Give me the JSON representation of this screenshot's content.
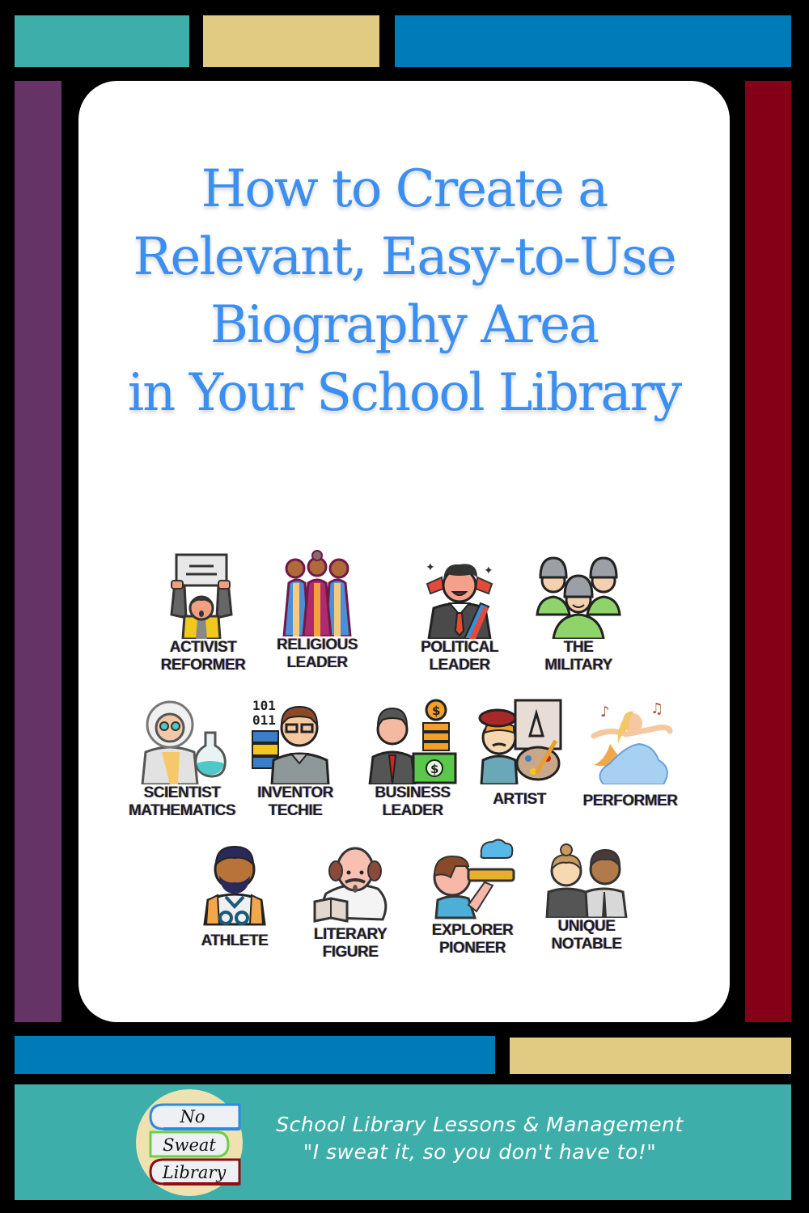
{
  "colors": {
    "teal": "#3eaeab",
    "tan": "#e1cb82",
    "blue": "#007bba",
    "purple": "#653366",
    "red": "#850017",
    "title_blue": "#3a8ff0"
  },
  "title": {
    "lines": [
      "How to Create a",
      "Relevant, Easy-to-Use",
      "Biography Area",
      "in Your School Library"
    ]
  },
  "categories": [
    {
      "icon": "activist-protester-icon",
      "lines": [
        "ACTIVIST",
        "REFORMER"
      ]
    },
    {
      "icon": "religious-leaders-icon",
      "lines": [
        "RELIGIOUS",
        "LEADER"
      ]
    },
    {
      "icon": "political-leader-icon",
      "lines": [
        "POLITICAL",
        "LEADER"
      ]
    },
    {
      "icon": "soldiers-icon",
      "lines": [
        "THE",
        "MILITARY"
      ]
    },
    {
      "icon": "scientist-flask-icon",
      "lines": [
        "SCIENTIST",
        "MATHEMATICS"
      ]
    },
    {
      "icon": "inventor-techie-icon",
      "lines": [
        "INVENTOR",
        "TECHIE"
      ]
    },
    {
      "icon": "businessman-money-icon",
      "lines": [
        "BUSINESS",
        "LEADER"
      ]
    },
    {
      "icon": "artist-palette-icon",
      "lines": [
        "ARTIST"
      ]
    },
    {
      "icon": "performer-singer-icon",
      "lines": [
        "PERFORMER"
      ]
    },
    {
      "icon": "athlete-icon",
      "lines": [
        "ATHLETE"
      ]
    },
    {
      "icon": "literary-figure-icon",
      "lines": [
        "LITERARY",
        "FIGURE"
      ]
    },
    {
      "icon": "explorer-spyglass-icon",
      "lines": [
        "EXPLORER",
        "PIONEER"
      ]
    },
    {
      "icon": "unique-notable-people-icon",
      "lines": [
        "UNIQUE",
        "NOTABLE"
      ]
    }
  ],
  "footer": {
    "logo": {
      "books": [
        "No",
        "Sweat",
        "Library"
      ]
    },
    "tagline": "School Library Lessons & Management",
    "motto": "\"I sweat it, so you don't have to!\""
  }
}
